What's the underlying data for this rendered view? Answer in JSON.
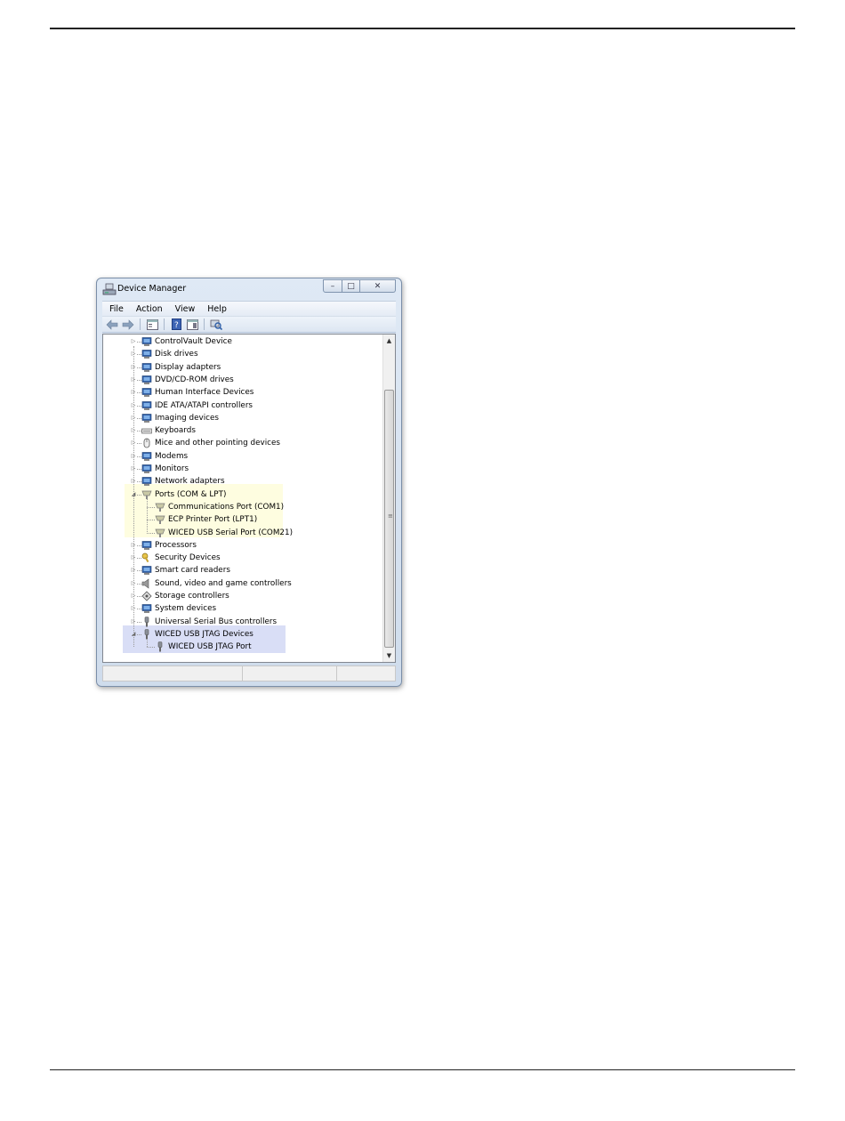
{
  "window": {
    "title": "Device Manager",
    "controls": {
      "minimize": "–",
      "maximize": "□",
      "close": "✕"
    }
  },
  "menu": [
    "File",
    "Action",
    "View",
    "Help"
  ],
  "toolbar": {
    "buttons": [
      "back-arrow-icon",
      "forward-arrow-icon",
      "properties-icon",
      "help-icon",
      "show-hide-console-tree-icon",
      "scan-hardware-icon"
    ]
  },
  "tree": {
    "items": [
      {
        "label": "ControlVault Device",
        "level": 0,
        "expander": "▷",
        "icon": "controlvault-icon"
      },
      {
        "label": "Disk drives",
        "level": 0,
        "expander": "▷",
        "icon": "disk-drive-icon"
      },
      {
        "label": "Display adapters",
        "level": 0,
        "expander": "▷",
        "icon": "display-adapter-icon"
      },
      {
        "label": "DVD/CD-ROM drives",
        "level": 0,
        "expander": "▷",
        "icon": "dvd-drive-icon"
      },
      {
        "label": "Human Interface Devices",
        "level": 0,
        "expander": "▷",
        "icon": "hid-icon"
      },
      {
        "label": "IDE ATA/ATAPI controllers",
        "level": 0,
        "expander": "▷",
        "icon": "ide-controller-icon"
      },
      {
        "label": "Imaging devices",
        "level": 0,
        "expander": "▷",
        "icon": "camera-icon"
      },
      {
        "label": "Keyboards",
        "level": 0,
        "expander": "▷",
        "icon": "keyboard-icon"
      },
      {
        "label": "Mice and other pointing devices",
        "level": 0,
        "expander": "▷",
        "icon": "mouse-icon"
      },
      {
        "label": "Modems",
        "level": 0,
        "expander": "▷",
        "icon": "modem-icon"
      },
      {
        "label": "Monitors",
        "level": 0,
        "expander": "▷",
        "icon": "monitor-icon"
      },
      {
        "label": "Network adapters",
        "level": 0,
        "expander": "▷",
        "icon": "network-adapter-icon"
      },
      {
        "label": "Ports (COM & LPT)",
        "level": 0,
        "expander": "◢",
        "icon": "port-icon",
        "expanded": true
      },
      {
        "label": "Communications Port (COM1)",
        "level": 1,
        "icon": "port-icon"
      },
      {
        "label": "ECP Printer Port (LPT1)",
        "level": 1,
        "icon": "port-icon"
      },
      {
        "label": "WICED USB Serial Port (COM21)",
        "level": 1,
        "icon": "port-icon"
      },
      {
        "label": "Processors",
        "level": 0,
        "expander": "▷",
        "icon": "processor-icon"
      },
      {
        "label": "Security Devices",
        "level": 0,
        "expander": "▷",
        "icon": "key-icon"
      },
      {
        "label": "Smart card readers",
        "level": 0,
        "expander": "▷",
        "icon": "smart-card-reader-icon"
      },
      {
        "label": "Sound, video and game controllers",
        "level": 0,
        "expander": "▷",
        "icon": "speaker-icon"
      },
      {
        "label": "Storage controllers",
        "level": 0,
        "expander": "▷",
        "icon": "storage-controller-icon"
      },
      {
        "label": "System devices",
        "level": 0,
        "expander": "▷",
        "icon": "system-device-icon"
      },
      {
        "label": "Universal Serial Bus controllers",
        "level": 0,
        "expander": "▷",
        "icon": "usb-plug-icon"
      },
      {
        "label": "WICED USB JTAG Devices",
        "level": 0,
        "expander": "◢",
        "icon": "usb-plug-icon",
        "expanded": true
      },
      {
        "label": "WICED USB JTAG Port",
        "level": 1,
        "icon": "usb-plug-icon"
      }
    ]
  },
  "scrollbar": {
    "up": "▲",
    "down": "▼",
    "grip": "≡"
  },
  "colors": {
    "ports_highlight": "#fefde0",
    "jtag_highlight": "#d9def6",
    "icon_blue": "#2f5fa8"
  }
}
